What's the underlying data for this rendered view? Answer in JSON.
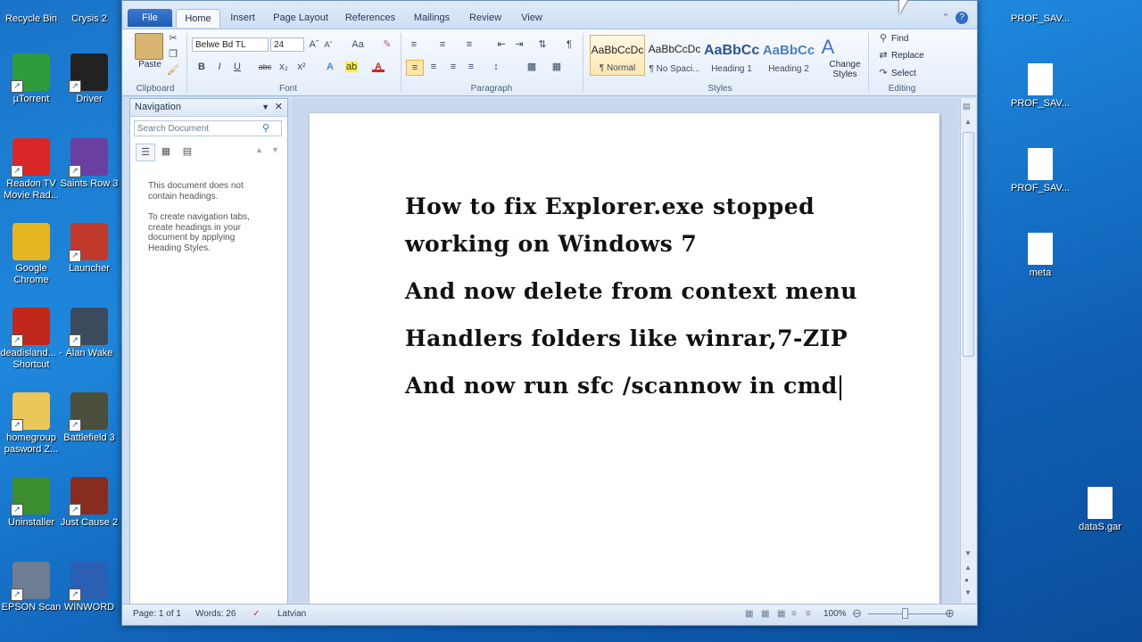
{
  "desktop": {
    "left_icons": [
      {
        "label": "Recycle Bin",
        "icon": "recycle-bin-icon",
        "color": "#9fb7cf"
      },
      {
        "label": "Crysis 2",
        "icon": "crysis-icon",
        "color": "#3b3b3b"
      },
      {
        "label": "µTorrent",
        "icon": "utorrent-icon",
        "color": "#2e9c3a"
      },
      {
        "label": "Driver",
        "icon": "driver-icon",
        "color": "#222222"
      },
      {
        "label": "Readon TV Movie Rad...",
        "icon": "tv-icon",
        "color": "#d92727"
      },
      {
        "label": "Saints Row 3",
        "icon": "saints-row-icon",
        "color": "#6a3fa0"
      },
      {
        "label": "Google Chrome",
        "icon": "chrome-icon",
        "color": "#e6b522"
      },
      {
        "label": "Launcher",
        "icon": "launcher-icon",
        "color": "#c0392b"
      },
      {
        "label": "deadisland... - Shortcut",
        "icon": "deadisland-icon",
        "color": "#c0281c"
      },
      {
        "label": "Alan Wake",
        "icon": "alan-wake-icon",
        "color": "#3c4a5e"
      },
      {
        "label": "homegroup pasword Z...",
        "icon": "folder-icon",
        "color": "#e9c75a"
      },
      {
        "label": "Battlefield 3",
        "icon": "battlefield-icon",
        "color": "#4a4f3d"
      },
      {
        "label": "Uninstaller",
        "icon": "uninstaller-icon",
        "color": "#3c8d2f"
      },
      {
        "label": "Just Cause 2",
        "icon": "just-cause-icon",
        "color": "#8a2b20"
      },
      {
        "label": "EPSON Scan",
        "icon": "scanner-icon",
        "color": "#6d7e93"
      },
      {
        "label": "WINWORD",
        "icon": "word-icon",
        "color": "#2b5fb4"
      }
    ],
    "right_icons": [
      {
        "label": "PROF_SAV...",
        "icon": "file-icon"
      },
      {
        "label": "PROF_SAV...",
        "icon": "file-icon"
      },
      {
        "label": "PROF_SAV...",
        "icon": "file-icon"
      },
      {
        "label": "meta",
        "icon": "html-file-icon"
      },
      {
        "label": "dataS.gar",
        "icon": "file-icon"
      }
    ]
  },
  "word": {
    "tabs": [
      "File",
      "Home",
      "Insert",
      "Page Layout",
      "References",
      "Mailings",
      "Review",
      "View"
    ],
    "clipboard": {
      "paste": "Paste",
      "label": "Clipboard"
    },
    "font": {
      "name": "Belwe Bd TL",
      "size": "24",
      "label": "Font",
      "bold": "B",
      "italic": "I",
      "underline": "U",
      "strike": "abc",
      "sub": "x₂",
      "sup": "x²"
    },
    "paragraph": {
      "label": "Paragraph"
    },
    "styles": {
      "items": [
        {
          "preview": "AaBbCcDc",
          "name": "¶ Normal"
        },
        {
          "preview": "AaBbCcDc",
          "name": "¶ No Spaci..."
        },
        {
          "preview": "AaBbCс",
          "name": "Heading 1"
        },
        {
          "preview": "AaBbCc",
          "name": "Heading 2"
        }
      ],
      "change": "Change Styles",
      "label": "Styles"
    },
    "editing": {
      "find": "Find",
      "replace": "Replace",
      "select": "Select",
      "label": "Editing"
    },
    "navigation": {
      "title": "Navigation",
      "search_placeholder": "Search Document",
      "message1": "This document does not contain headings.",
      "message2": "To create navigation tabs, create headings in your document by applying Heading Styles."
    },
    "document_lines": [
      "How to fix Explorer.exe stopped",
      "working on Windows 7",
      "And now delete from context menu",
      "Handlers folders like winrar,7-ZIP",
      "And now run sfc /scannow in cmd"
    ],
    "status": {
      "page": "Page: 1 of 1",
      "words": "Words: 26",
      "language": "Latvian",
      "zoom": "100%"
    }
  },
  "colors": {
    "accent": "#1f5db5",
    "desktop": "#1a74c9"
  }
}
